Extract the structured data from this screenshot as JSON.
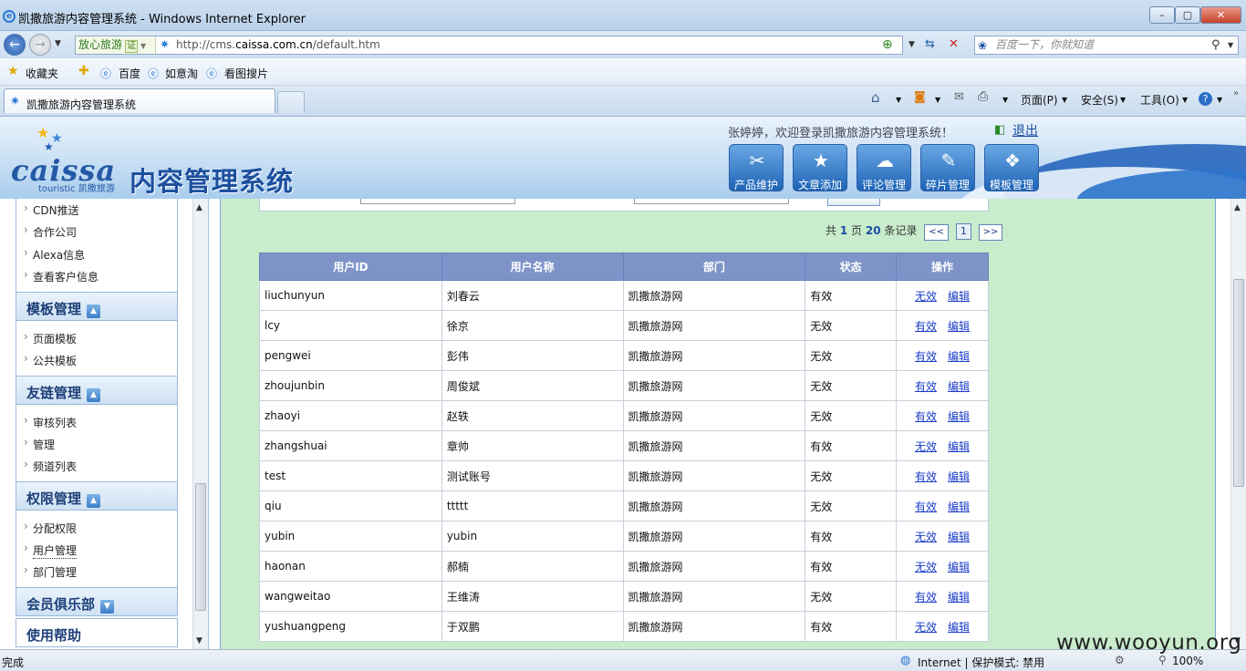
{
  "window": {
    "title": "凯撒旅游内容管理系统 - Windows Internet Explorer",
    "min": "–",
    "max": "▢",
    "close": "✕"
  },
  "address": {
    "zone": "放心旅游",
    "cert": "证",
    "url_prefix": "http://cms.",
    "url_domain": "caissa.com.cn",
    "url_suffix": "/default.htm",
    "search_placeholder": "百度一下，你就知道"
  },
  "favorites": {
    "label": "收藏夹",
    "items": [
      "百度",
      "如意淘",
      "看图搜片"
    ]
  },
  "tabs": {
    "active": "凯撒旅游内容管理系统"
  },
  "commands": {
    "page": "页面(P)",
    "safety": "安全(S)",
    "tools": "工具(O)"
  },
  "header": {
    "logo_word": "caissa",
    "logo_sub": "touristic 凯撒旅游",
    "system_title": "内容管理系统",
    "welcome": "张婷婷，欢迎登录凯撒旅游内容管理系统！",
    "logout": "退出",
    "buttons": [
      "产品维护",
      "文章添加",
      "评论管理",
      "碎片管理",
      "模板管理"
    ]
  },
  "sidebar": {
    "top_items": [
      "CDN推送",
      "合作公司",
      "Alexa信息",
      "查看客户信息"
    ],
    "sections": [
      {
        "title": "模板管理",
        "items": [
          "页面模板",
          "公共模板"
        ]
      },
      {
        "title": "友链管理",
        "items": [
          "审核列表",
          "管理",
          "频道列表"
        ]
      },
      {
        "title": "权限管理",
        "items": [
          "分配权限",
          "用户管理",
          "部门管理"
        ]
      },
      {
        "title": "会员俱乐部",
        "items": []
      },
      {
        "title": "使用帮助",
        "items": []
      }
    ],
    "toggle_up": "▲",
    "toggle_down": "▼"
  },
  "pager": {
    "prefix": "共",
    "pages": "1",
    "mid": "页",
    "records": "20",
    "suffix": "条记录",
    "prev": "<<",
    "current": "1",
    "next": ">>"
  },
  "table": {
    "headers": [
      "用户ID",
      "用户名称",
      "部门",
      "状态",
      "操作"
    ],
    "action_edit": "编辑",
    "rows": [
      {
        "id": "liuchunyun",
        "name": "刘春云",
        "dept": "凯撒旅游网",
        "status": "有效",
        "toggle": "无效"
      },
      {
        "id": "lcy",
        "name": "徐京",
        "dept": "凯撒旅游网",
        "status": "无效",
        "toggle": "有效"
      },
      {
        "id": "pengwei",
        "name": "彭伟",
        "dept": "凯撒旅游网",
        "status": "无效",
        "toggle": "有效"
      },
      {
        "id": "zhoujunbin",
        "name": "周俊斌",
        "dept": "凯撒旅游网",
        "status": "无效",
        "toggle": "有效"
      },
      {
        "id": "zhaoyi",
        "name": "赵轶",
        "dept": "凯撒旅游网",
        "status": "无效",
        "toggle": "有效"
      },
      {
        "id": "zhangshuai",
        "name": "章帅",
        "dept": "凯撒旅游网",
        "status": "有效",
        "toggle": "无效"
      },
      {
        "id": "test",
        "name": "测试账号",
        "dept": "凯撒旅游网",
        "status": "无效",
        "toggle": "有效"
      },
      {
        "id": "qiu",
        "name": "ttttt",
        "dept": "凯撒旅游网",
        "status": "无效",
        "toggle": "有效"
      },
      {
        "id": "yubin",
        "name": "yubin",
        "dept": "凯撒旅游网",
        "status": "有效",
        "toggle": "无效"
      },
      {
        "id": "haonan",
        "name": "郝楠",
        "dept": "凯撒旅游网",
        "status": "有效",
        "toggle": "无效"
      },
      {
        "id": "wangweitao",
        "name": "王维涛",
        "dept": "凯撒旅游网",
        "status": "无效",
        "toggle": "有效"
      },
      {
        "id": "yushuangpeng",
        "name": "于双鹏",
        "dept": "凯撒旅游网",
        "status": "有效",
        "toggle": "无效"
      }
    ]
  },
  "status": {
    "done": "完成",
    "zone": "Internet | 保护模式: 禁用",
    "zoom": "100%"
  },
  "watermark": "www.wooyun.org",
  "colors": {
    "table_header": "#7e94c9",
    "content_bg": "#c8eccc",
    "link": "#1a3cc8"
  }
}
